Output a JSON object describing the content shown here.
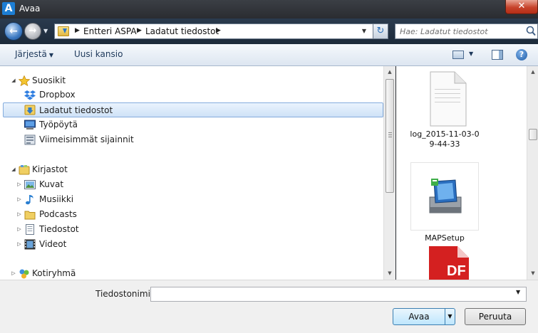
{
  "window": {
    "app_icon_letter": "A",
    "title": "Avaa",
    "close_glyph": "✕"
  },
  "address_bar": {
    "breadcrumbs": [
      "Entteri ASPA",
      "Ladatut tiedostot"
    ],
    "search_placeholder": "Hae: Ladatut tiedostot"
  },
  "toolbar": {
    "organize_label": "Järjestä",
    "new_folder_label": "Uusi kansio",
    "help_glyph": "?"
  },
  "navigation": {
    "favorites": {
      "label": "Suosikit",
      "items": [
        {
          "label": "Dropbox",
          "icon": "dropbox-icon"
        },
        {
          "label": "Ladatut tiedostot",
          "icon": "downloads-folder-icon",
          "selected": true
        },
        {
          "label": "Työpöytä",
          "icon": "desktop-icon"
        },
        {
          "label": "Viimeisimmät sijainnit",
          "icon": "recent-places-icon"
        }
      ]
    },
    "libraries": {
      "label": "Kirjastot",
      "items": [
        {
          "label": "Kuvat",
          "icon": "pictures-icon"
        },
        {
          "label": "Musiikki",
          "icon": "music-icon"
        },
        {
          "label": "Podcasts",
          "icon": "folder-icon"
        },
        {
          "label": "Tiedostot",
          "icon": "documents-icon"
        },
        {
          "label": "Videot",
          "icon": "videos-icon"
        }
      ]
    },
    "homegroup": {
      "label": "Kotiryhmä"
    }
  },
  "files": [
    {
      "name": "log_2015-11-03-09-44-33",
      "icon": "text-file-icon"
    },
    {
      "name": "MAPSetup",
      "icon": "installer-icon"
    },
    {
      "name": "",
      "icon": "pdf-file-icon",
      "partial_text": "DF"
    }
  ],
  "bottom": {
    "filename_label": "Tiedostonimi:",
    "filename_value": "",
    "open_label": "Avaa",
    "cancel_label": "Peruuta"
  },
  "colors": {
    "selection_bg": "#cfe2f7",
    "selection_border": "#84acdd",
    "toolbar_text": "#1e395b",
    "pdf_red": "#d42020"
  }
}
